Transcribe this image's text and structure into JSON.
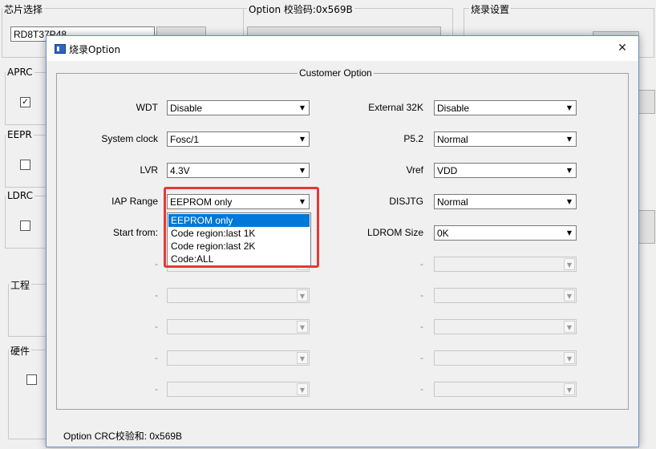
{
  "background": {
    "chip_group_label": "芯片选择",
    "chip_value": "RD8T37P48",
    "option_group_label": "Option 校验码:0x569B",
    "burn_group_label": "烧录设置",
    "side_labels": [
      "APRC",
      "EEPR",
      "LDRC"
    ],
    "section_labels": [
      "工程",
      "硬件"
    ]
  },
  "dialog": {
    "title": "烧录Option",
    "close_symbol": "✕",
    "group_title": "Customer Option",
    "footer": "Option CRC校验和: 0x569B",
    "left_rows": [
      {
        "label": "WDT",
        "value": "Disable"
      },
      {
        "label": "System clock",
        "value": "Fosc/1"
      },
      {
        "label": "LVR",
        "value": "4.3V"
      },
      {
        "label": "IAP Range",
        "value": "EEPROM only"
      },
      {
        "label": "Start from:",
        "value": ""
      },
      {
        "label": "-",
        "value": ""
      },
      {
        "label": "-",
        "value": ""
      },
      {
        "label": "-",
        "value": ""
      },
      {
        "label": "-",
        "value": ""
      },
      {
        "label": "-",
        "value": ""
      }
    ],
    "right_rows": [
      {
        "label": "External 32K",
        "value": "Disable"
      },
      {
        "label": "P5.2",
        "value": "Normal"
      },
      {
        "label": "Vref",
        "value": "VDD"
      },
      {
        "label": "DISJTG",
        "value": "Normal"
      },
      {
        "label": "LDROM Size",
        "value": "0K"
      },
      {
        "label": "-",
        "value": ""
      },
      {
        "label": "-",
        "value": ""
      },
      {
        "label": "-",
        "value": ""
      },
      {
        "label": "-",
        "value": ""
      },
      {
        "label": "-",
        "value": ""
      }
    ],
    "iap_dropdown_options": [
      "EEPROM only",
      "Code region:last 1K",
      "Code region:last 2K",
      "Code:ALL"
    ],
    "iap_selected": "EEPROM only"
  },
  "colors": {
    "highlight_box": "#e53935",
    "selection": "#0078d7"
  }
}
